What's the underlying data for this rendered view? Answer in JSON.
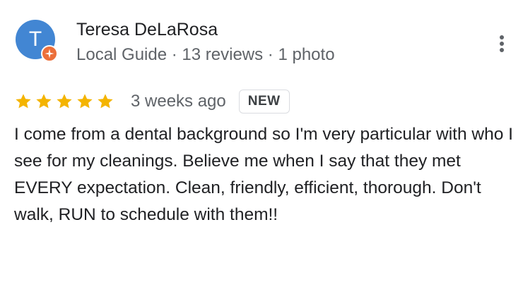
{
  "reviewer": {
    "avatar_initial": "T",
    "avatar_color": "#4286d3",
    "badge_color": "#ec6f3a",
    "badge_icon": "local-guide-star-icon",
    "name": "Teresa DeLaRosa",
    "level": "Local Guide",
    "separator": " · ",
    "reviews_count": "13 reviews",
    "photos_count": "1 photo"
  },
  "menu": {
    "icon": "more-vert-icon"
  },
  "rating": {
    "stars": 5,
    "max_stars": 5,
    "star_color": "#f4b400",
    "date": "3 weeks ago",
    "badge": "NEW"
  },
  "review": {
    "text": "I come from a dental background so I'm very particular with who I see for my cleanings. Believe me when I say that they met EVERY expectation. Clean, friendly, efficient, thorough. Don't walk, RUN to schedule with them!!"
  }
}
